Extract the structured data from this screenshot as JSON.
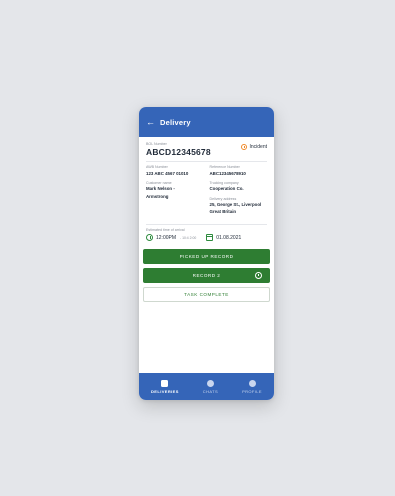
{
  "header": {
    "title": "Delivery"
  },
  "bol": {
    "label": "BOL Number",
    "value": "ABCD12345678",
    "incident_label": "Incident"
  },
  "fields": {
    "awb_label": "AWB Number",
    "awb_value": "123 ABC 4567 01010",
    "ref_label": "Reference Number",
    "ref_value": "ABC12345678910",
    "customer_label": "Customer name",
    "customer_value_1": "Mark Nelson -",
    "customer_value_2": "Armstrong",
    "trucking_label": "Trucking company",
    "trucking_value": "Cooperation Co.",
    "address_label": "Delivery address",
    "address_value_1": "25, George St., Liverpool",
    "address_value_2": "Great Britain"
  },
  "eta": {
    "label": "Estimated time of arrival",
    "time": "12:00PM",
    "time_sub": "- 10:4 2:00",
    "date": "01.08.2021"
  },
  "buttons": {
    "picked_up": "PICKED UP RECORD",
    "record": "RECORD 2",
    "task_complete": "TASK COMPLETE"
  },
  "nav": {
    "deliveries": "DELIVERIES",
    "chats": "CHATS",
    "profile": "PROFILE"
  }
}
